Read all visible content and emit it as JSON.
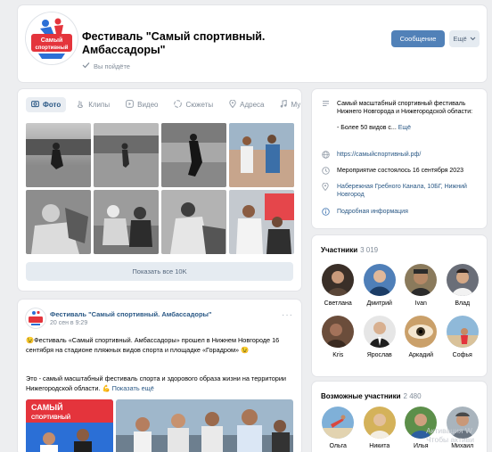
{
  "header": {
    "title": "Фестиваль \"Самый спортивный. Амбассадоры\"",
    "status": "Вы пойдёте",
    "message_button": "Сообщение",
    "more_button": "Ещё",
    "logo_text": "Самый спортивный"
  },
  "tabs": [
    {
      "label": "Фото",
      "icon": "photo-icon"
    },
    {
      "label": "Клипы",
      "icon": "clips-icon"
    },
    {
      "label": "Видео",
      "icon": "video-icon"
    },
    {
      "label": "Сюжеты",
      "icon": "stories-icon"
    },
    {
      "label": "Адреса",
      "icon": "location-icon"
    },
    {
      "label": "Му",
      "icon": "music-icon"
    }
  ],
  "photos": {
    "show_all": "Показать все 10K"
  },
  "post": {
    "author": "Фестиваль \"Самый спортивный. Амбассадоры\"",
    "date": "20 сен в 9:29",
    "text": "Фестиваль «Самый спортивный. Амбассадоры» прошел в Нижнем Новгороде 16 сентября на стадионе пляжных видов спорта и площадке «Горадром»",
    "text2": "Это - самый масштабный фестиваль спорта и здорового образа жизни на территории Нижегородской области.",
    "show_more": "Показать ещё",
    "banner_text": "САМЫЙ СПОРТИВНЫЙ"
  },
  "info": {
    "description": "Самый масштабный спортивный фестиваль Нижнего Новгорода и Нижегородской области:",
    "bullet": "- Более 50 видов с...",
    "more": "Ещё",
    "link": "https://самыйспортивный.рф/",
    "event_date": "Мероприятие состоялось 16 сентября 2023",
    "address": "Набережная Гребного Канала, 10БГ, Нижний Новгород",
    "details": "Подробная информация"
  },
  "members": {
    "title": "Участники",
    "count": "3 019",
    "list": [
      "Светлана",
      "Дмитрий",
      "Ivan",
      "Влад",
      "Kris",
      "Ярослав",
      "Аркадий",
      "Софья"
    ]
  },
  "possible": {
    "title": "Возможные участники",
    "count": "2 480",
    "list": [
      "Ольга",
      "Никита",
      "Илья",
      "Михаил"
    ]
  },
  "watermark": {
    "line1": "Активация W",
    "line2": "Чтобы активи"
  },
  "colors": {
    "accent": "#5181b8",
    "link": "#2a5885",
    "background": "#edeef0"
  }
}
